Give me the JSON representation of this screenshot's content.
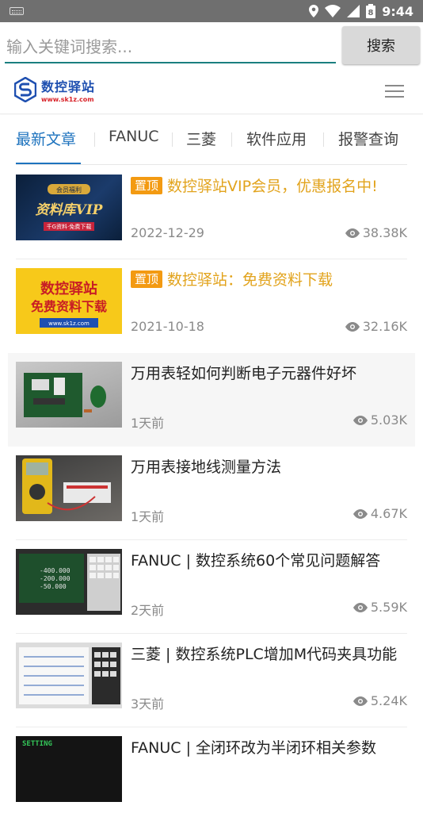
{
  "statusbar": {
    "time": "9:44",
    "battery": "8"
  },
  "search": {
    "placeholder": "输入关键词搜索...",
    "button": "搜索"
  },
  "header": {
    "logo_name": "数控驿站",
    "logo_url": "www.sk1z.com"
  },
  "tabs": [
    "最新文章",
    "FANUC",
    "三菱",
    "软件应用",
    "报警查询"
  ],
  "articles": [
    {
      "pin": "置顶",
      "title": "数控驿站VIP会员，优惠报名中!",
      "date": "2022-12-29",
      "views": "38.38K",
      "thumb_text": [
        "会员福利",
        "资料库VIP",
        "千G资料·免费下载"
      ]
    },
    {
      "pin": "置顶",
      "title": "数控驿站：免费资料下载",
      "date": "2021-10-18",
      "views": "32.16K",
      "thumb_text": [
        "数控驿站",
        "免费资料下载",
        "www.sk1z.com"
      ]
    },
    {
      "title": "万用表轻如何判断电子元器件好坏",
      "date": "1天前",
      "views": "5.03K"
    },
    {
      "title": "万用表接地线测量方法",
      "date": "1天前",
      "views": "4.67K"
    },
    {
      "title": "FANUC | 数控系统60个常见问题解答",
      "date": "2天前",
      "views": "5.59K",
      "thumb_text": [
        "-400.000",
        "-200.000",
        "-50.000"
      ]
    },
    {
      "title": "三菱 | 数控系统PLC增加M代码夹具功能",
      "date": "3天前",
      "views": "5.24K"
    },
    {
      "title": "FANUC | 全闭环改为半闭环相关参数",
      "thumb_text": [
        "SETTING"
      ]
    }
  ]
}
